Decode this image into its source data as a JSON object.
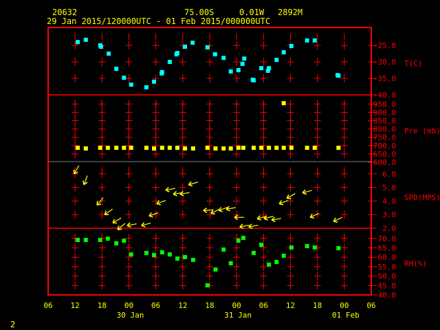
{
  "header": {
    "station_id": "20632",
    "latitude": "75.00S",
    "longitude": "0.01W",
    "elevation": "2892M",
    "period": "29 Jan 2015/120000UTC - 01 Feb 2015/000000UTC"
  },
  "page_number": "2",
  "colors": {
    "frame": "#ff0000",
    "text": "#ffff00",
    "temperature": "#00ffff",
    "pressure": "#ffff00",
    "wind": "#ffff00",
    "rh": "#00ff00"
  },
  "chart_data": {
    "type": "scatter",
    "x_unit": "hours since 29 Jan 2015 06 UTC",
    "x_range": [
      0,
      72
    ],
    "x_tick_labels": [
      "06",
      "12",
      "18",
      "00",
      "06",
      "12",
      "18",
      "00",
      "06",
      "12",
      "18",
      "00",
      "06"
    ],
    "date_labels": [
      {
        "label": "30 Jan",
        "hour": 18
      },
      {
        "label": "31 Jan",
        "hour": 42
      },
      {
        "label": "01 Feb",
        "hour": 66
      }
    ],
    "panels": [
      {
        "name": "temperature",
        "label": "T(C)",
        "ylim": [
          -40,
          -19.6
        ],
        "tick_values": [
          -25,
          -30,
          -35,
          -40
        ],
        "tick_labels": [
          "-25.0",
          "-30.0",
          "-35.0",
          "-40.0"
        ],
        "points": [
          [
            6.6,
            -24.0
          ],
          [
            8.4,
            -23.3
          ],
          [
            11.6,
            -25.0
          ],
          [
            11.8,
            -25.4
          ],
          [
            13.5,
            -27.5
          ],
          [
            15.2,
            -32.1
          ],
          [
            16.9,
            -34.8
          ],
          [
            18.5,
            -36.9
          ],
          [
            21.9,
            -37.7
          ],
          [
            23.6,
            -36.0
          ],
          [
            25.3,
            -33.5
          ],
          [
            25.4,
            -33.1
          ],
          [
            27.1,
            -30.0
          ],
          [
            28.6,
            -27.7
          ],
          [
            28.8,
            -27.3
          ],
          [
            30.5,
            -25.4
          ],
          [
            32.2,
            -24.2
          ],
          [
            35.5,
            -25.6
          ],
          [
            37.2,
            -27.7
          ],
          [
            39.1,
            -28.8
          ],
          [
            40.7,
            -32.9
          ],
          [
            42.4,
            -32.5
          ],
          [
            43.3,
            -30.6
          ],
          [
            43.7,
            -29.0
          ],
          [
            45.6,
            -35.4
          ],
          [
            45.8,
            -35.6
          ],
          [
            47.5,
            -31.9
          ],
          [
            49.0,
            -32.7
          ],
          [
            49.2,
            -31.9
          ],
          [
            50.9,
            -29.4
          ],
          [
            52.5,
            -27.1
          ],
          [
            54.2,
            -25.2
          ],
          [
            57.7,
            -23.5
          ],
          [
            59.4,
            -23.5
          ],
          [
            64.5,
            -34.0
          ],
          [
            64.7,
            -34.2
          ]
        ]
      },
      {
        "name": "pressure",
        "label": "Pre (mb)",
        "ylim": [
          600,
          1000
        ],
        "tick_values": [
          950,
          900,
          850,
          800,
          750,
          700,
          650,
          600
        ],
        "tick_labels": [
          "950.0",
          "900.0",
          "850.0",
          "800.0",
          "750.0",
          "700.0",
          "650.0",
          "600.0"
        ],
        "points": [
          [
            6.6,
            687
          ],
          [
            8.4,
            683
          ],
          [
            11.6,
            687
          ],
          [
            13.3,
            687
          ],
          [
            15.2,
            687
          ],
          [
            16.9,
            687
          ],
          [
            18.5,
            687
          ],
          [
            21.9,
            687
          ],
          [
            23.6,
            683
          ],
          [
            25.4,
            687
          ],
          [
            27.1,
            687
          ],
          [
            28.8,
            687
          ],
          [
            30.5,
            683
          ],
          [
            32.3,
            683
          ],
          [
            35.5,
            687
          ],
          [
            37.3,
            683
          ],
          [
            39.1,
            683
          ],
          [
            40.7,
            683
          ],
          [
            42.4,
            687
          ],
          [
            43.5,
            687
          ],
          [
            45.8,
            687
          ],
          [
            47.5,
            687
          ],
          [
            49.2,
            687
          ],
          [
            50.9,
            687
          ],
          [
            52.5,
            955
          ],
          [
            52.5,
            687
          ],
          [
            54.2,
            687
          ],
          [
            57.7,
            687
          ],
          [
            59.4,
            687
          ],
          [
            64.7,
            687
          ]
        ]
      },
      {
        "name": "wind",
        "label": "SPD(MPS)",
        "ylim": [
          2,
          6.95
        ],
        "tick_values": [
          6,
          5,
          4,
          3,
          2
        ],
        "tick_labels": [
          "6.0",
          "5.0",
          "4.0",
          "3.0",
          "2.0"
        ],
        "points_hour_speed_dirfrom": [
          [
            5.8,
            6.0,
            30
          ],
          [
            8.0,
            5.2,
            20
          ],
          [
            10.9,
            3.7,
            40
          ],
          [
            12.6,
            3.0,
            55
          ],
          [
            14.4,
            2.4,
            60
          ],
          [
            15.5,
            1.9,
            50
          ],
          [
            17.6,
            2.2,
            80
          ],
          [
            20.8,
            2.2,
            75
          ],
          [
            22.5,
            2.9,
            70
          ],
          [
            24.2,
            3.8,
            70
          ],
          [
            26.2,
            4.8,
            80
          ],
          [
            27.9,
            4.5,
            80
          ],
          [
            29.4,
            4.5,
            80
          ],
          [
            31.3,
            5.2,
            75
          ],
          [
            34.6,
            3.3,
            85
          ],
          [
            36.3,
            3.1,
            65
          ],
          [
            38.0,
            3.3,
            70
          ],
          [
            39.7,
            3.4,
            80
          ],
          [
            41.5,
            2.8,
            90
          ],
          [
            42.7,
            2.1,
            80
          ],
          [
            44.7,
            2.1,
            80
          ],
          [
            46.6,
            2.7,
            75
          ],
          [
            48.1,
            2.7,
            75
          ],
          [
            49.8,
            2.6,
            80
          ],
          [
            51.5,
            3.8,
            70
          ],
          [
            53.2,
            4.2,
            60
          ],
          [
            56.7,
            4.6,
            75
          ],
          [
            58.4,
            2.8,
            65
          ],
          [
            63.6,
            2.5,
            65
          ]
        ]
      },
      {
        "name": "rh",
        "label": "RH(%)",
        "ylim": [
          40,
          72
        ],
        "tick_values": [
          70,
          65,
          60,
          55,
          50,
          45,
          40
        ],
        "tick_labels": [
          "70.0",
          "65.0",
          "60.0",
          "55.0",
          "50.0",
          "45.0",
          "40.0"
        ],
        "points": [
          [
            6.6,
            69.2
          ],
          [
            8.4,
            69.2
          ],
          [
            11.6,
            69.2
          ],
          [
            13.3,
            69.9
          ],
          [
            15.2,
            67.4
          ],
          [
            16.9,
            68.8
          ],
          [
            18.5,
            61.5
          ],
          [
            21.9,
            62.3
          ],
          [
            23.6,
            61.2
          ],
          [
            25.4,
            62.6
          ],
          [
            27.1,
            61.5
          ],
          [
            28.8,
            59.3
          ],
          [
            30.5,
            60.1
          ],
          [
            32.3,
            58.6
          ],
          [
            35.5,
            45.1
          ],
          [
            37.3,
            53.5
          ],
          [
            39.1,
            64.1
          ],
          [
            40.7,
            56.8
          ],
          [
            42.4,
            68.8
          ],
          [
            43.5,
            70.3
          ],
          [
            45.8,
            62.3
          ],
          [
            47.5,
            66.6
          ],
          [
            49.2,
            56.1
          ],
          [
            50.9,
            57.5
          ],
          [
            52.5,
            60.8
          ],
          [
            54.2,
            65.2
          ],
          [
            57.7,
            65.9
          ],
          [
            59.4,
            65.2
          ],
          [
            64.7,
            64.8
          ]
        ]
      }
    ]
  }
}
